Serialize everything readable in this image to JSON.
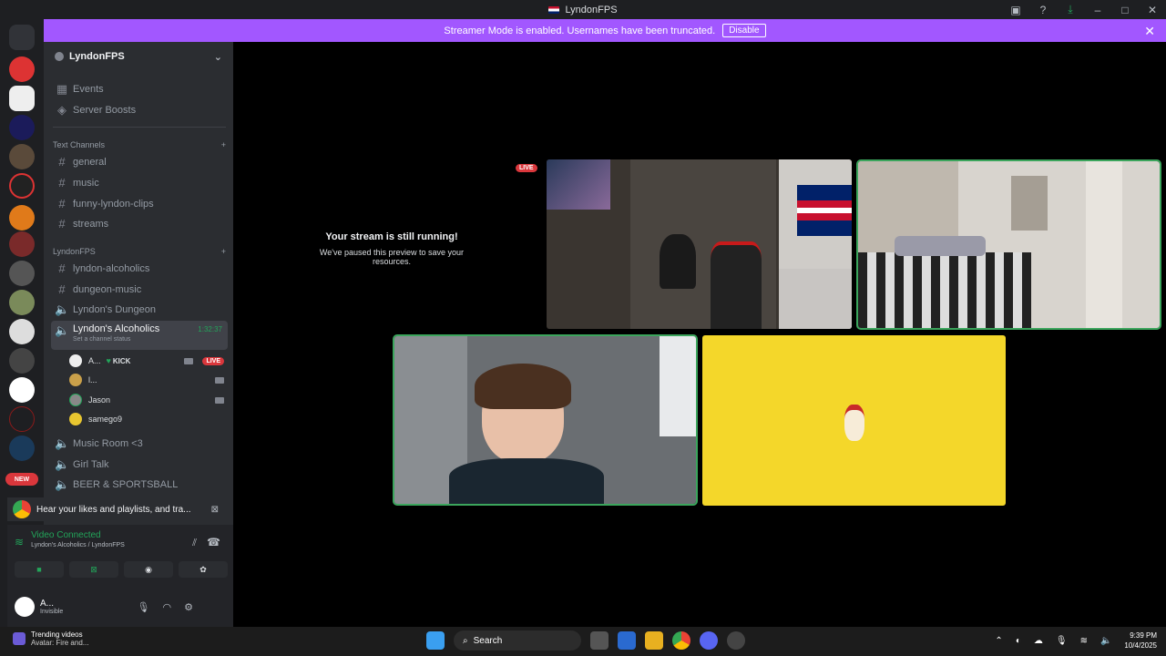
{
  "window": {
    "title": "LyndonFPS"
  },
  "banner": {
    "text": "Streamer Mode is enabled. Usernames have been truncated.",
    "disable_label": "Disable"
  },
  "server": {
    "name": "LyndonFPS",
    "events": "Events",
    "boosts": "Server Boosts",
    "text_category": "Text Channels",
    "text_channels": [
      "general",
      "music",
      "funny-lyndon-clips",
      "streams"
    ],
    "category2": "LyndonFPS",
    "cat2_text": [
      "lyndon-alcoholics",
      "dungeon-music"
    ],
    "dungeon": "Lyndon's Dungeon",
    "active_voice": {
      "name": "Lyndon's Alcoholics",
      "timer": "1:32:37",
      "status": "Set a channel status"
    },
    "voice_users": [
      {
        "name": "A...",
        "tag": "KICK",
        "live": "LIVE"
      },
      {
        "name": "l..."
      },
      {
        "name": "Jason"
      },
      {
        "name": "samego9"
      }
    ],
    "other_voice": [
      "Music Room <3",
      "Girl Talk",
      "BEER & SPORTSBALL"
    ]
  },
  "new_badge": "NEW",
  "promo": {
    "text": "Hear your likes and playlists, and tra..."
  },
  "rtc": {
    "status": "Video Connected",
    "location": "Lyndon's Alcoholics / LyndonFPS"
  },
  "user": {
    "name": "A...",
    "status": "Invisible"
  },
  "stage": {
    "paused_title": "Your stream is still running!",
    "paused_sub": "We've paused this preview to save your resources.",
    "live": "LIVE"
  },
  "taskbar": {
    "news_title": "Trending videos",
    "news_sub": "Avatar: Fire and...",
    "search": "Search",
    "time": "9:39 PM",
    "date": "10/4/2025"
  },
  "colors": {
    "accent": "#a257ff",
    "live": "#da373c",
    "connected": "#23a55a",
    "speaking": "#3ba55c",
    "tile_yellow": "#f4d72a"
  }
}
